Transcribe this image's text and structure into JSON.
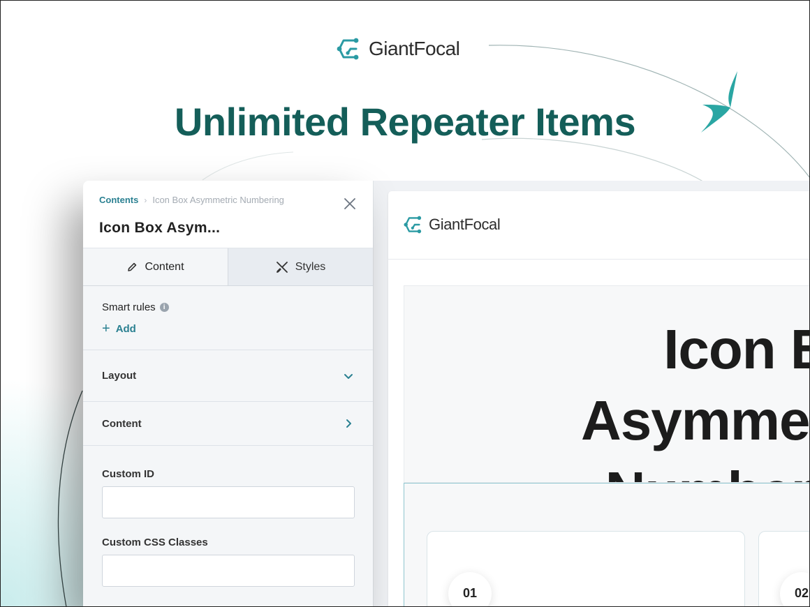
{
  "brand": {
    "name": "GiantFocal",
    "accent": "#2a9aa3"
  },
  "headline": "Unlimited Repeater Items",
  "editor": {
    "breadcrumb": {
      "root": "Contents",
      "current": "Icon Box Asymmetric Numbering"
    },
    "title": "Icon Box Asym...",
    "tabs": [
      {
        "label": "Content",
        "icon": "pencil-icon",
        "active": true
      },
      {
        "label": "Styles",
        "icon": "brush-ruler-icon",
        "active": false
      }
    ],
    "smart_rules": {
      "label": "Smart rules",
      "add_label": "Add"
    },
    "sections": [
      {
        "label": "Layout",
        "state": "expanded"
      },
      {
        "label": "Content",
        "state": "collapsed"
      }
    ],
    "fields": [
      {
        "label": "Custom ID",
        "value": ""
      },
      {
        "label": "Custom CSS Classes",
        "value": ""
      }
    ]
  },
  "preview": {
    "site_brand": "GiantFocal",
    "hero_title": "Icon Box Asymmetric\nNumbering",
    "cards": [
      {
        "number": "01"
      },
      {
        "number": "02"
      }
    ]
  }
}
